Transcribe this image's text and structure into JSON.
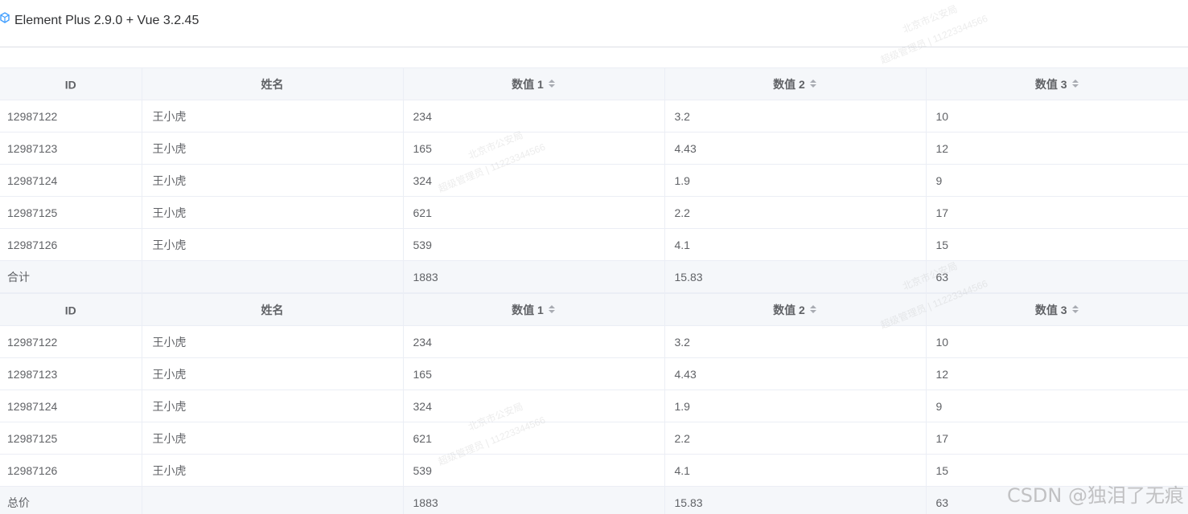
{
  "header": {
    "title": "Element Plus 2.9.0 + Vue 3.2.45",
    "logo_icon": "cube-icon"
  },
  "table1": {
    "columns": [
      "ID",
      "姓名",
      "数值 1",
      "数值 2",
      "数值 3"
    ],
    "rows": [
      [
        "12987122",
        "王小虎",
        "234",
        "3.2",
        "10"
      ],
      [
        "12987123",
        "王小虎",
        "165",
        "4.43",
        "12"
      ],
      [
        "12987124",
        "王小虎",
        "324",
        "1.9",
        "9"
      ],
      [
        "12987125",
        "王小虎",
        "621",
        "2.2",
        "17"
      ],
      [
        "12987126",
        "王小虎",
        "539",
        "4.1",
        "15"
      ]
    ],
    "footer": [
      "合计",
      "",
      "1883",
      "15.83",
      "63"
    ]
  },
  "table2": {
    "columns": [
      "ID",
      "姓名",
      "数值 1",
      "数值 2",
      "数值 3"
    ],
    "rows": [
      [
        "12987122",
        "王小虎",
        "234",
        "3.2",
        "10"
      ],
      [
        "12987123",
        "王小虎",
        "165",
        "4.43",
        "12"
      ],
      [
        "12987124",
        "王小虎",
        "324",
        "1.9",
        "9"
      ],
      [
        "12987125",
        "王小虎",
        "621",
        "2.2",
        "17"
      ],
      [
        "12987126",
        "王小虎",
        "539",
        "4.1",
        "15"
      ]
    ],
    "footer": [
      "总价",
      "",
      "1883",
      "15.83",
      "63"
    ]
  },
  "watermark": {
    "line1": "北京市公安局",
    "line2": "超级管理员 | 11223344566",
    "credit": "CSDN @独泪了无痕"
  },
  "colors": {
    "header_bg": "#f5f7fa",
    "border": "#ebeef5",
    "text": "#606266",
    "logo": "#409eff"
  }
}
